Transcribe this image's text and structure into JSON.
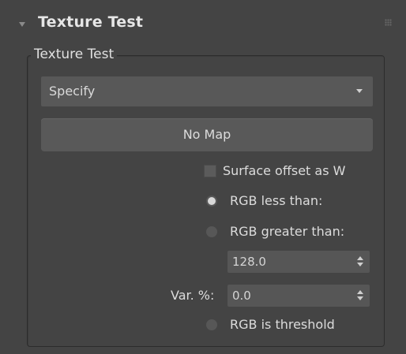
{
  "rollout": {
    "title": "Texture Test",
    "collapse_icon": "triangle-down-icon",
    "grip_icon": "drag-grip-icon"
  },
  "group": {
    "legend": "Texture Test"
  },
  "dropdown": {
    "selected": "Specify",
    "arrow_icon": "chevron-down-icon"
  },
  "map_button": {
    "label": "No Map"
  },
  "surface_offset": {
    "label": "Surface offset as W",
    "checked": false
  },
  "mode_radios": [
    {
      "label": "RGB less than:",
      "selected": true
    },
    {
      "label": "RGB greater than:",
      "selected": false
    }
  ],
  "threshold": {
    "value": "128.0"
  },
  "variance": {
    "label": "Var. %:",
    "value": "0.0"
  },
  "rgb_is_threshold": {
    "label": "RGB is threshold",
    "selected": false
  },
  "colors": {
    "panel_bg": "#444444",
    "control_bg": "#585858",
    "text": "#dcdcdc"
  }
}
